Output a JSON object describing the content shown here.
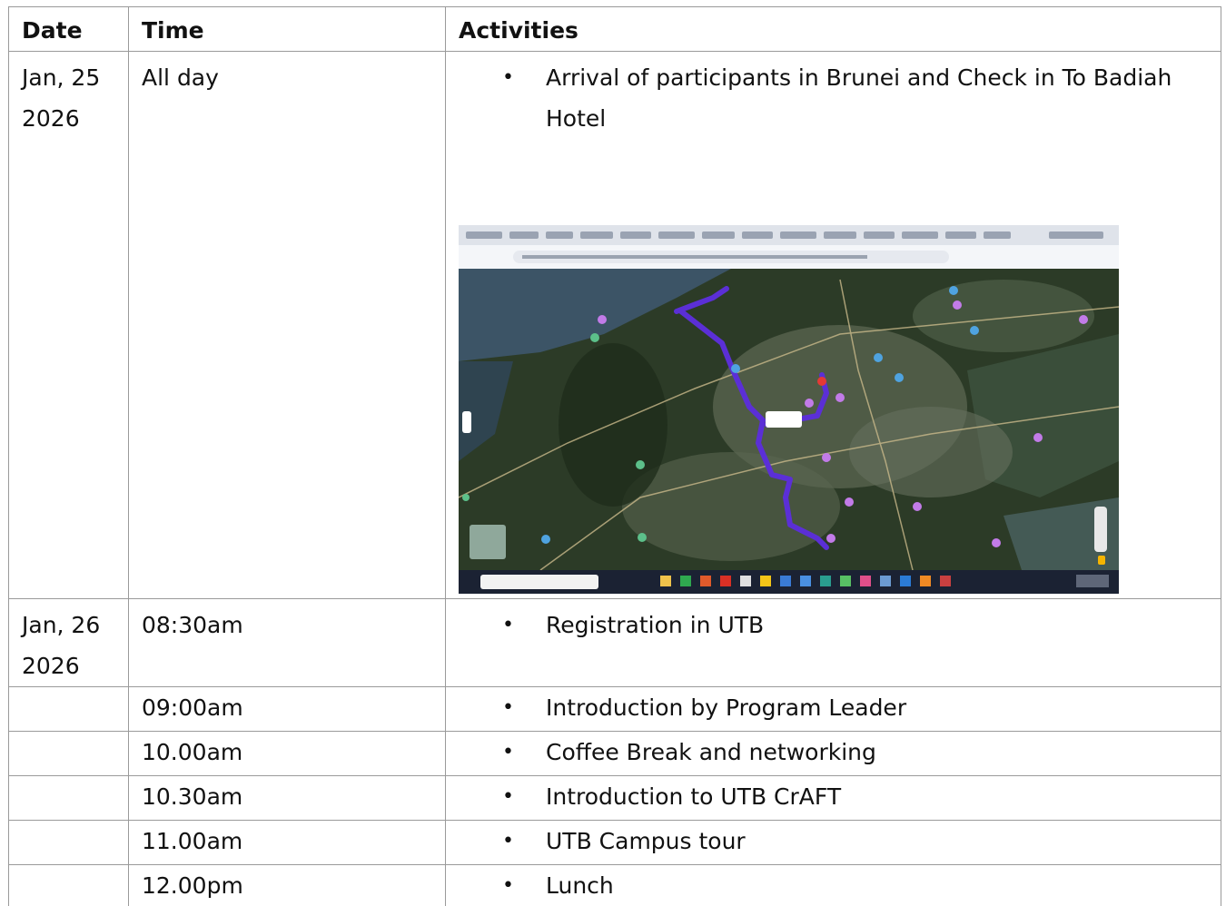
{
  "table": {
    "headers": [
      "Date",
      "Time",
      "Activities"
    ],
    "rows": [
      {
        "date_line1": "Jan, 25",
        "date_line2": "2026",
        "time": "All day",
        "activity": "Arrival of participants in Brunei and Check in To Badiah Hotel"
      },
      {
        "date_line1": "Jan, 26",
        "date_line2": "2026",
        "time": "08:30am",
        "activity": "Registration in UTB"
      },
      {
        "date_line1": "",
        "date_line2": "",
        "time": "09:00am",
        "activity": "Introduction by Program Leader"
      },
      {
        "date_line1": "",
        "date_line2": "",
        "time": "10.00am",
        "activity": "Coffee Break and networking"
      },
      {
        "date_line1": "",
        "date_line2": "",
        "time": "10.30am",
        "activity": "Introduction to UTB CrAFT"
      },
      {
        "date_line1": "",
        "date_line2": "",
        "time": "11.00am",
        "activity": "UTB Campus tour"
      },
      {
        "date_line1": "",
        "date_line2": "",
        "time": "12.00pm",
        "activity": "Lunch"
      }
    ]
  },
  "bullet_glyph": "•",
  "embedded_image": {
    "description_icon": "map-screenshot",
    "route_color": "#5b2fd6",
    "pin_color": "#e53935"
  }
}
